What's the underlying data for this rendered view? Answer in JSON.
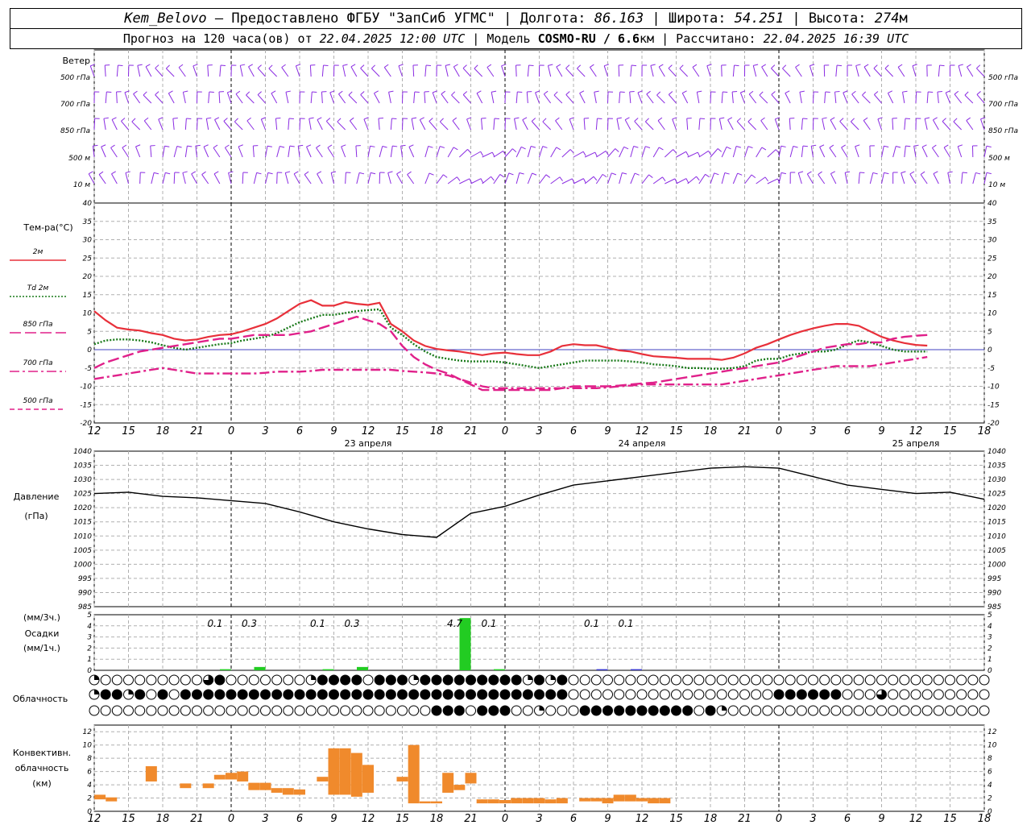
{
  "header": {
    "station": "Kem_Belovo",
    "provider": " – Предоставлено ФГБУ \"ЗапСиб УГМС\" | Долгота: ",
    "lon": "86.163",
    "lat_label": " | Широта: ",
    "lat": "54.251",
    "alt_label": " | Высота: ",
    "alt": "274",
    "alt_unit": "м",
    "forecast_prefix": "Прогноз на 120 часа(ов) от ",
    "forecast_time": "22.04.2025 12:00 UTC",
    "model_label": " | Модель ",
    "model": "COSMO-RU / 6.6",
    "model_unit": "км",
    "calc_label": " | Рассчитано: ",
    "calc_time": "22.04.2025 16:39 UTC"
  },
  "wind_panel": {
    "title": "Ветер",
    "levels": [
      "500 гПа",
      "700 гПа",
      "850 гПа",
      "500 м",
      "10 м"
    ],
    "color": "#8a2be2"
  },
  "temp_panel": {
    "title": "Тем-ра(°C)",
    "legend": [
      {
        "label": "2м",
        "color": "#e8303a",
        "dash": "solid"
      },
      {
        "label": "Td 2м",
        "color": "#1a7a1a",
        "dash": "dot"
      },
      {
        "label": "850 гПа",
        "color": "#e0208a",
        "dash": "long"
      },
      {
        "label": "700 гПа",
        "color": "#e0208a",
        "dash": "dashdot"
      },
      {
        "label": "500 гПа",
        "color": "#e0208a",
        "dash": "short"
      }
    ],
    "yticks": [
      "40",
      "35",
      "30",
      "25",
      "20",
      "15",
      "10",
      "5",
      "0",
      "-5",
      "-10",
      "-15",
      "-20"
    ]
  },
  "pressure_panel": {
    "title": "Давление",
    "unit": "(гПа)",
    "yticks": [
      "1040",
      "1035",
      "1030",
      "1025",
      "1020",
      "1015",
      "1010",
      "1005",
      "1000",
      "995",
      "990",
      "985"
    ]
  },
  "precip_panel": {
    "unit3": "(мм/3ч.)",
    "title": "Осадки",
    "unit1": "(мм/1ч.)",
    "yticks": [
      "5",
      "4",
      "3",
      "2",
      "1",
      "0"
    ],
    "labels": [
      {
        "t": 12,
        "text": "0.1"
      },
      {
        "t": 15,
        "text": "0.3"
      },
      {
        "t": 21,
        "text": "0.1"
      },
      {
        "t": 24,
        "text": "0.3"
      },
      {
        "t": 33,
        "text": "4.7"
      },
      {
        "t": 36,
        "text": "0.1"
      },
      {
        "t": 45,
        "text": "0.1"
      },
      {
        "t": 48,
        "text": "0.1"
      }
    ]
  },
  "cloud_panel": {
    "title": "Облачность",
    "rows": [
      "1000000000340000000144440444144444444414140000000000000000000000000000000000000000000000000000000000000000040000140044444440000000000000000000000000000000000000001400000000000000000000000000000000000000000000000000000000000000000000000000000000000000000000000000003400000001000000000000000000000000000001040000000000000000000000000000000000000000000000000000000000000000000000000000000000000000000000000000000000000000000000000000000000000000000000",
      "1441404044444444444444444444444444444444440000000000000000004444440003000000000001300030000000000000000000000000000000000000000000000000000000000000000000000000000000000000000000000000000000000000000000000000000000000000000000000000000000000000000000000000000000000000000000000000000000000000000000000000000000000000000000000000000000000000000000000000000000000000000000000000000000000000000000000000000000000000000000000000000000000000000000000000000000000",
      "0000000000000000000000000000004440444001000444444444404100000000000000000000000000000000000000000000000000000000000000000000000000000000000000000000000000000000000000000000000000000000000000000000000000000000000000000000000000000000000000000000000000000000000000000000000000000000000000000000000000000000000000000000000000000000000000000000000000000000000000000000000000000000000000000000000000000000000000000000000000000000000000000000000000000000000000000000000"
    ]
  },
  "conv_panel": {
    "title1": "Конвективн.",
    "title2": "облачность",
    "unit": "(км)",
    "yticks": [
      "12",
      "10",
      "8",
      "6",
      "4",
      "2",
      "0"
    ],
    "color": "#f08a2c"
  },
  "time_axis": {
    "hour_labels": [
      "12",
      "15",
      "18",
      "21",
      "0",
      "3",
      "6",
      "9",
      "12",
      "15",
      "18",
      "21",
      "0",
      "3",
      "6",
      "9",
      "12",
      "15",
      "18",
      "21",
      "0",
      "3",
      "6",
      "9",
      "12",
      "15",
      "18"
    ],
    "days": [
      {
        "t": 24,
        "text": "23 апреля"
      },
      {
        "t": 48,
        "text": "24 апреля"
      },
      {
        "t": 72,
        "text": "25 апреля"
      }
    ]
  },
  "chart_data": [
    {
      "type": "line",
      "title": "Тем-ра(°C)",
      "ylim": [
        -20,
        40
      ],
      "x_hours_from_start": [
        0,
        1,
        2,
        3,
        4,
        5,
        6,
        7,
        8,
        9,
        10,
        11,
        12,
        13,
        14,
        15,
        16,
        17,
        18,
        19,
        20,
        21,
        22,
        23,
        24,
        25,
        26,
        27,
        28,
        29,
        30,
        31,
        32,
        33,
        34,
        35,
        36,
        37,
        38,
        39,
        40,
        41,
        42,
        43,
        44,
        45,
        46,
        47,
        48,
        49,
        50,
        51,
        52,
        53,
        54,
        55,
        56,
        57,
        58,
        59,
        60,
        61,
        62,
        63,
        64,
        65,
        66,
        67,
        68,
        69,
        70,
        71,
        72,
        73,
        74,
        75,
        76,
        77,
        78
      ],
      "series": [
        {
          "name": "2м",
          "values": [
            10.5,
            8,
            6,
            5.5,
            5.2,
            4.5,
            4,
            3,
            2.5,
            2.8,
            3.5,
            4,
            4.2,
            5,
            6,
            7,
            8.5,
            10.5,
            12.5,
            13.5,
            12,
            12,
            13,
            12.5,
            12.2,
            12.8,
            7,
            5,
            2.5,
            1,
            0.2,
            -0.2,
            -0.5,
            -1,
            -1.5,
            -1,
            -0.8,
            -1.2,
            -1.5,
            -1.5,
            -0.5,
            1,
            1.5,
            1.2,
            1.2,
            0.5,
            -0.2,
            -0.5,
            -1.2,
            -1.8,
            -2,
            -2.2,
            -2.5,
            -2.5,
            -2.5,
            -2.8,
            -2.2,
            -1,
            0.5,
            1.5,
            2.8,
            4,
            5,
            5.8,
            6.5,
            7,
            7,
            6.5,
            5,
            3.5,
            2.5,
            1.8,
            1.3,
            1.1
          ]
        },
        {
          "name": "Td 2м",
          "values": [
            1.5,
            2.5,
            2.8,
            2.8,
            2.5,
            2,
            1.2,
            0.5,
            0,
            0.5,
            1,
            1.5,
            1.8,
            2.5,
            3,
            3.5,
            4.5,
            6,
            7.5,
            8.5,
            9.5,
            9.5,
            10,
            10.5,
            10.8,
            11,
            6,
            4,
            1.5,
            -0.5,
            -2,
            -2.5,
            -3,
            -3.2,
            -3.2,
            -3.2,
            -3.5,
            -4,
            -4.5,
            -5,
            -4.5,
            -4,
            -3.5,
            -3,
            -3,
            -3,
            -3,
            -3.2,
            -3.5,
            -4,
            -4.2,
            -4.5,
            -5,
            -5,
            -5.2,
            -5.2,
            -5,
            -4.5,
            -3,
            -2.5,
            -2.5,
            -1.5,
            -1,
            -0.5,
            -0.5,
            0,
            1.5,
            2.5,
            2,
            1,
            0,
            -0.5,
            -0.5,
            -0.5
          ]
        },
        {
          "name": "850 гПа",
          "values": [
            -5,
            -3.5,
            -2.5,
            -1.5,
            -0.5,
            0,
            0.5,
            1,
            1.5,
            2,
            2.5,
            3,
            3,
            3.5,
            4,
            4,
            4,
            4,
            4.5,
            5,
            6,
            7,
            8,
            9,
            8,
            7,
            5,
            1,
            -2,
            -4,
            -5.5,
            -6.5,
            -8,
            -9.5,
            -11,
            -11,
            -11,
            -11,
            -11,
            -11,
            -11,
            -10.5,
            -10,
            -10,
            -10,
            -10,
            -9.8,
            -9.5,
            -9.2,
            -9,
            -8.5,
            -8,
            -7.5,
            -7,
            -6.5,
            -6,
            -5.5,
            -5,
            -4.5,
            -4,
            -3.5,
            -2.5,
            -1.5,
            -0.5,
            0.5,
            1,
            1.5,
            1.5,
            2,
            2,
            3,
            3.5,
            3.8,
            4
          ]
        },
        {
          "name": "700 гПа",
          "values": [
            -8,
            -7.5,
            -7,
            -6.5,
            -6,
            -5.5,
            -5,
            -5.5,
            -6,
            -6.5,
            -6.5,
            -6.5,
            -6.5,
            -6.5,
            -6.5,
            -6.3,
            -6,
            -6,
            -6,
            -5.8,
            -5.5,
            -5.5,
            -5.5,
            -5.5,
            -5.5,
            -5.5,
            -5.5,
            -5.8,
            -6,
            -6.2,
            -6.5,
            -7,
            -8,
            -9,
            -10,
            -10.5,
            -10.5,
            -10.5,
            -10.5,
            -10.5,
            -10.5,
            -10.5,
            -10.5,
            -10.5,
            -10.5,
            -10.3,
            -10,
            -9.8,
            -9.5,
            -9.5,
            -9.5,
            -9.5,
            -9.5,
            -9.5,
            -9.5,
            -9.5,
            -9,
            -8.5,
            -8,
            -7.5,
            -7,
            -6.5,
            -6,
            -5.5,
            -5,
            -4.5,
            -4.5,
            -4.5,
            -4.5,
            -4,
            -3.5,
            -3,
            -2.5,
            -2
          ]
        },
        {
          "name": "500 гПа",
          "values": [
            -20,
            -20,
            -20,
            -20,
            -20,
            -20,
            -20,
            -20,
            -20,
            -20,
            -20,
            -20,
            -20,
            -20,
            -20,
            -20,
            -20,
            -20,
            -20,
            -20,
            -20,
            -20,
            -20,
            -20,
            -20,
            -20,
            -20,
            -20,
            -20,
            -20,
            -20,
            -20,
            -20,
            -13,
            -14,
            -14.5,
            -15,
            -15.5,
            -15.5,
            -15.5,
            -15.5,
            -15,
            -14.5,
            -14,
            -13,
            -12.5,
            -12,
            -12,
            -11.5,
            -11,
            -11,
            -11,
            -11,
            -11,
            -11,
            -11,
            -11,
            -11,
            -11,
            -11,
            -11,
            -10,
            -9,
            -8,
            -7,
            -6,
            -5,
            -4.5,
            -4.5,
            -4.5,
            -4.5,
            -4,
            -3.5,
            -3
          ]
        }
      ],
      "series_note_hidden": "",
      "xlabel": "",
      "ylabel": "Тем-ра(°C)"
    },
    {
      "type": "line",
      "title": "Давление",
      "ylabel": "(гПа)",
      "ylim": [
        985,
        1040
      ],
      "x_hours_from_start": [
        0,
        3,
        6,
        9,
        12,
        15,
        18,
        21,
        24,
        27,
        30,
        33,
        36,
        39,
        42,
        45,
        48,
        51,
        54,
        57,
        60,
        63,
        66,
        69,
        72,
        75,
        78
      ],
      "series": [
        {
          "name": "",
          "values": [
            1025,
            1025.5,
            1024,
            1023.5,
            1022.5,
            1021.5,
            1018.5,
            1015,
            1012.5,
            1010.5,
            1009.5,
            1018,
            1020.5,
            1024.5,
            1028,
            1029.5,
            1031,
            1032.5,
            1034,
            1034.5,
            1034,
            1031,
            1028,
            1026.5,
            1025,
            1025.5,
            1023
          ]
        }
      ]
    },
    {
      "type": "bar",
      "title": "Осадки",
      "ylabel": "(мм/3ч.)",
      "ylim": [
        0,
        5
      ],
      "x_hours_from_start": [
        12,
        15,
        21,
        24,
        33,
        36,
        45,
        48
      ],
      "series": [
        {
          "name": "",
          "values": [
            0.1,
            0.3,
            0.1,
            0.3,
            4.7,
            0.1,
            0.1,
            0.1
          ],
          "colors": [
            "#22cc22",
            "#22cc22",
            "#22cc22",
            "#22cc22",
            "#22cc22",
            "#22cc22",
            "#3333cc",
            "#3333cc"
          ]
        }
      ]
    },
    {
      "type": "bar",
      "title": "Конвективн. облачность",
      "ylabel": "(км)",
      "ylim": [
        0,
        13
      ],
      "bars": [
        {
          "t": 0.5,
          "bottom": 1.8,
          "top": 2.5
        },
        {
          "t": 1.5,
          "bottom": 1.5,
          "top": 2.1
        },
        {
          "t": 5,
          "bottom": 4.5,
          "top": 6.8
        },
        {
          "t": 8,
          "bottom": 3.5,
          "top": 4.2
        },
        {
          "t": 10,
          "bottom": 3.5,
          "top": 4.2
        },
        {
          "t": 11,
          "bottom": 4.8,
          "top": 5.5
        },
        {
          "t": 12,
          "bottom": 4.8,
          "top": 5.8
        },
        {
          "t": 13,
          "bottom": 4.5,
          "top": 6
        },
        {
          "t": 14,
          "bottom": 3.2,
          "top": 4.3
        },
        {
          "t": 15,
          "bottom": 3.2,
          "top": 4.3
        },
        {
          "t": 16,
          "bottom": 2.8,
          "top": 3.5
        },
        {
          "t": 17,
          "bottom": 2.5,
          "top": 3.5
        },
        {
          "t": 18,
          "bottom": 2.5,
          "top": 3.3
        },
        {
          "t": 20,
          "bottom": 4.5,
          "top": 5.2
        },
        {
          "t": 21,
          "bottom": 2.5,
          "top": 9.5
        },
        {
          "t": 22,
          "bottom": 2.5,
          "top": 9.5
        },
        {
          "t": 23,
          "bottom": 2.2,
          "top": 8.8
        },
        {
          "t": 24,
          "bottom": 2.8,
          "top": 7
        },
        {
          "t": 27,
          "bottom": 4.5,
          "top": 5.2
        },
        {
          "t": 28,
          "bottom": 1.2,
          "top": 10
        },
        {
          "t": 29,
          "bottom": 1.2,
          "top": 1.5
        },
        {
          "t": 30,
          "bottom": 1.2,
          "top": 1.5
        },
        {
          "t": 31,
          "bottom": 2.8,
          "top": 5.8
        },
        {
          "t": 32,
          "bottom": 3.2,
          "top": 4
        },
        {
          "t": 33,
          "bottom": 4.2,
          "top": 5.8
        },
        {
          "t": 34,
          "bottom": 1.2,
          "top": 1.8
        },
        {
          "t": 35,
          "bottom": 1.2,
          "top": 1.8
        },
        {
          "t": 36,
          "bottom": 1.2,
          "top": 1.7
        },
        {
          "t": 37,
          "bottom": 1.2,
          "top": 2
        },
        {
          "t": 38,
          "bottom": 1.2,
          "top": 2
        },
        {
          "t": 39,
          "bottom": 1.2,
          "top": 2
        },
        {
          "t": 40,
          "bottom": 1.2,
          "top": 1.8
        },
        {
          "t": 41,
          "bottom": 1.2,
          "top": 2
        },
        {
          "t": 43,
          "bottom": 1.5,
          "top": 2
        },
        {
          "t": 44,
          "bottom": 1.5,
          "top": 2
        },
        {
          "t": 45,
          "bottom": 1.2,
          "top": 2
        },
        {
          "t": 46,
          "bottom": 1.5,
          "top": 2.5
        },
        {
          "t": 47,
          "bottom": 1.5,
          "top": 2.5
        },
        {
          "t": 48,
          "bottom": 1.5,
          "top": 2
        },
        {
          "t": 49,
          "bottom": 1.2,
          "top": 2
        },
        {
          "t": 50,
          "bottom": 1.2,
          "top": 2
        }
      ]
    }
  ]
}
